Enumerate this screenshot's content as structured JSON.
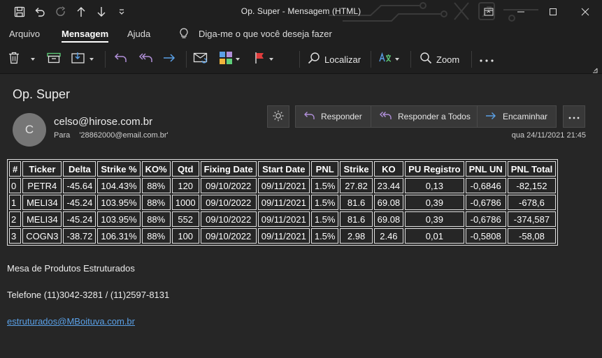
{
  "window": {
    "title": "Op. Super  -  Mensagem (HTML)"
  },
  "menu": {
    "items": [
      "Arquivo",
      "Mensagem",
      "Ajuda"
    ],
    "active": "Mensagem",
    "search_prompt": "Diga-me o que você deseja fazer"
  },
  "ribbon": {
    "find_label": "Localizar",
    "zoom_label": "Zoom"
  },
  "message": {
    "subject": "Op. Super",
    "avatar_initial": "C",
    "sender": "celso@hirose.com.br",
    "to_label": "Para",
    "to_value": "'28862000@email.com.br'",
    "date": "qua 24/11/2021 21:45",
    "actions": {
      "reply": "Responder",
      "reply_all": "Responder a Todos",
      "forward": "Encaminhar"
    }
  },
  "table": {
    "headers": [
      "#",
      "Ticker",
      "Delta",
      "Strike %",
      "KO%",
      "Qtd",
      "Fixing Date",
      "Start Date",
      "PNL",
      "Strike",
      "KO",
      "PU Registro",
      "PNL UN",
      "PNL Total"
    ],
    "rows": [
      [
        "0",
        "PETR4",
        "-45.64",
        "104.43%",
        "88%",
        "120",
        "09/10/2022",
        "09/11/2021",
        "1.5%",
        "27.82",
        "23.44",
        "0,13",
        "-0,6846",
        "-82,152"
      ],
      [
        "1",
        "MELI34",
        "-45.24",
        "103.95%",
        "88%",
        "1000",
        "09/10/2022",
        "09/11/2021",
        "1.5%",
        "81.6",
        "69.08",
        "0,39",
        "-0,6786",
        "-678,6"
      ],
      [
        "2",
        "MELI34",
        "-45.24",
        "103.95%",
        "88%",
        "552",
        "09/10/2022",
        "09/11/2021",
        "1.5%",
        "81.6",
        "69.08",
        "0,39",
        "-0,6786",
        "-374,587"
      ],
      [
        "3",
        "COGN3",
        "-38.72",
        "106.31%",
        "88%",
        "100",
        "09/10/2022",
        "09/11/2021",
        "1.5%",
        "2.98",
        "2.46",
        "0,01",
        "-0,5808",
        "-58,08"
      ]
    ]
  },
  "signature": {
    "desk": "Mesa de Produtos Estruturados",
    "phone": "Telefone (11)3042-3281 / (11)2597-8131",
    "email": "estruturados@MBoituva.com.br"
  },
  "colors": {
    "background": "#262626",
    "chrome": "#1f1f1f",
    "accent_purple": "#b08fd8",
    "accent_blue": "#5aa0e6",
    "flag_red": "#e03c3c"
  }
}
